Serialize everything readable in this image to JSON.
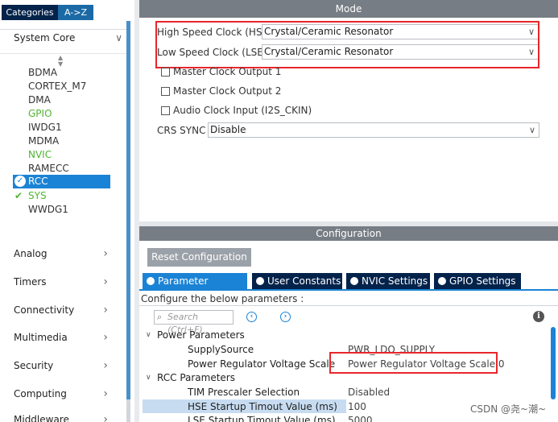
{
  "left_panel": {
    "tabs": [
      "Categories",
      "A->Z"
    ],
    "system_core": {
      "label": "System Core",
      "peripherals": [
        {
          "label": "BDMA",
          "state": "normal"
        },
        {
          "label": "CORTEX_M7",
          "state": "normal"
        },
        {
          "label": "DMA",
          "state": "normal"
        },
        {
          "label": "GPIO",
          "state": "green"
        },
        {
          "label": "IWDG1",
          "state": "normal"
        },
        {
          "label": "MDMA",
          "state": "normal"
        },
        {
          "label": "NVIC",
          "state": "green"
        },
        {
          "label": "RAMECC",
          "state": "normal"
        },
        {
          "label": "RCC",
          "state": "selected-checked"
        },
        {
          "label": "SYS",
          "state": "checked"
        },
        {
          "label": "WWDG1",
          "state": "normal"
        }
      ]
    },
    "categories": [
      "Analog",
      "Timers",
      "Connectivity",
      "Multimedia",
      "Security",
      "Computing",
      "Middleware"
    ]
  },
  "mode": {
    "header": "Mode",
    "hse_label": "High Speed Clock (HSE)",
    "hse_value": "Crystal/Ceramic Resonator",
    "lse_label": "Low Speed Clock (LSE)",
    "lse_value": "Crystal/Ceramic Resonator",
    "checkboxes": [
      "Master Clock Output 1",
      "Master Clock Output 2",
      "Audio Clock Input (I2S_CKIN)"
    ],
    "crs_label": "CRS SYNC",
    "crs_value": "Disable"
  },
  "configuration": {
    "header": "Configuration",
    "reset_button": "Reset Configuration",
    "tabs": [
      "Parameter Settings",
      "User Constants",
      "NVIC Settings",
      "GPIO Settings"
    ],
    "hint": "Configure the below parameters :",
    "search_placeholder": "Search (Ctrl+F)",
    "groups": [
      {
        "title": "Power Parameters",
        "params": [
          {
            "name": "SupplySource",
            "value": "PWR_LDO_SUPPLY"
          },
          {
            "name": "Power Regulator Voltage Scale",
            "value": "Power Regulator Voltage Scale 0"
          }
        ]
      },
      {
        "title": "RCC Parameters",
        "params": [
          {
            "name": "TIM Prescaler Selection",
            "value": "Disabled"
          },
          {
            "name": "HSE Startup Timout Value (ms)",
            "value": "100"
          },
          {
            "name": "LSE Startup Timout Value (ms)",
            "value": "5000"
          }
        ]
      }
    ]
  },
  "watermark": "CSDN @尧~潮~",
  "colors": {
    "accent": "#1b83d5",
    "dark_tab": "#03234b",
    "header_gray": "#777d84",
    "highlight_red": "#e8262b",
    "green": "#4fb52f"
  }
}
